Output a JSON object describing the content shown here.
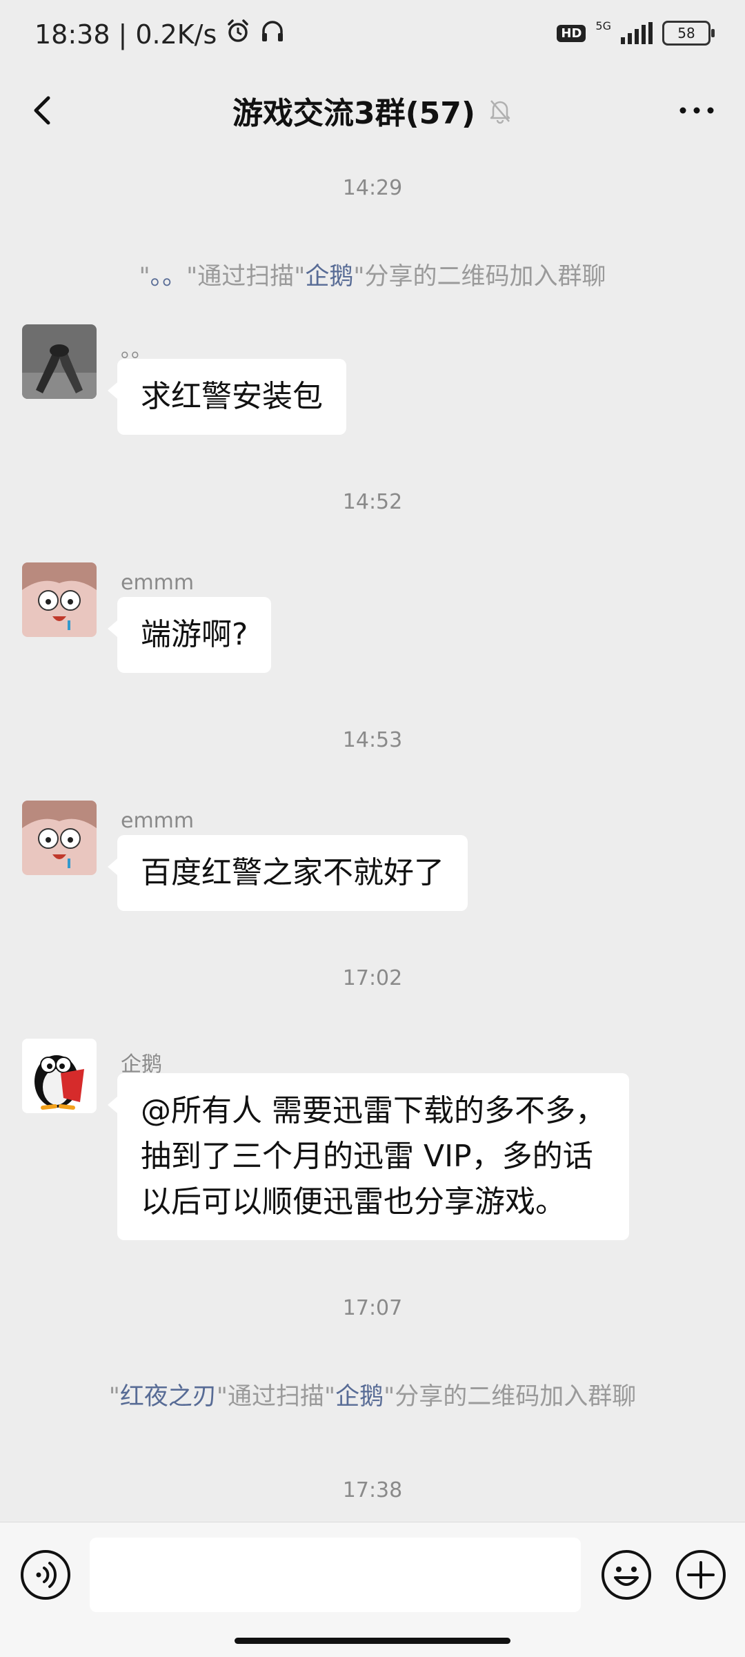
{
  "status_bar": {
    "time": "18:38",
    "speed": "0.2K/s",
    "hd": "HD",
    "network": "5G",
    "battery": "58"
  },
  "header": {
    "title": "游戏交流3群(57)"
  },
  "chat": {
    "ts1": "14:29",
    "sys1": {
      "q1": "\"",
      "name": "。。",
      "mid": "\"通过扫描\"",
      "inviter": "企鹅",
      "tail": "\"分享的二维码加入群聊"
    },
    "msg1": {
      "sender": "。。",
      "text": "求红警安装包"
    },
    "ts2": "14:52",
    "msg2": {
      "sender": "emmm",
      "text": "端游啊?"
    },
    "ts3": "14:53",
    "msg3": {
      "sender": "emmm",
      "text": "百度红警之家不就好了"
    },
    "ts4": "17:02",
    "msg4": {
      "sender": "企鹅",
      "lines": [
        "@所有人  需要迅雷下载的多不多，",
        "抽到了三个月的迅雷 VIP，多的话",
        "以后可以顺便迅雷也分享游戏。"
      ]
    },
    "ts5": "17:07",
    "sys2": {
      "q1": "\"",
      "name": "红夜之刃",
      "mid": "\"通过扫描\"",
      "inviter": "企鹅",
      "tail": "\"分享的二维码加入群聊"
    },
    "ts6": "17:38"
  },
  "input": {
    "value": ""
  },
  "colors": {
    "background": "#ededed",
    "link": "#576b95",
    "bubble": "#ffffff"
  },
  "icons": [
    "back-icon",
    "mute-bell-icon",
    "more-icon",
    "voice-icon",
    "emoji-icon",
    "plus-icon",
    "alarm-icon",
    "headphones-icon"
  ]
}
